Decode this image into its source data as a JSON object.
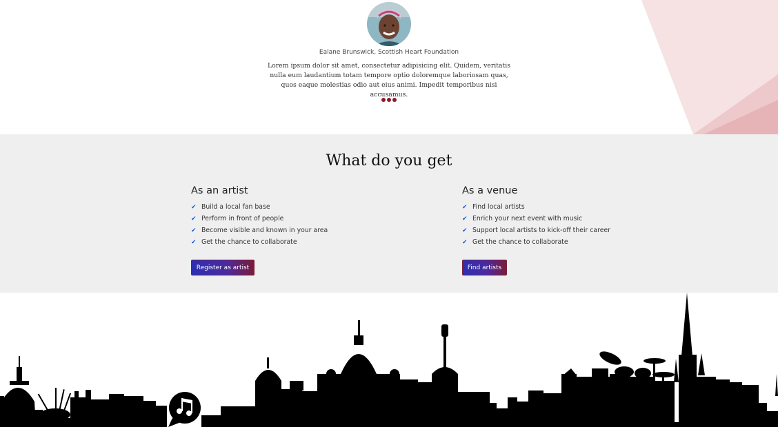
{
  "testimonial": {
    "author": "Ealane Brunswick, Scottish Heart Foundation",
    "quote": "Lorem ipsum dolor sit amet, consectetur adipisicing elit. Quidem, veritatis nulla eum laudantium totam tempore optio doloremque laboriosam quas, quos eaque molestias odio aut eius animi. Impedit temporibus nisi accusamus.",
    "slide_count": 3
  },
  "benefits": {
    "title": "What do you get",
    "artist": {
      "heading": "As an artist",
      "items": [
        "Build a local fan base",
        "Perform in front of people",
        "Become visible and known in your area",
        "Get the chance to collaborate"
      ],
      "button": "Register as artist"
    },
    "venue": {
      "heading": "As a venue",
      "items": [
        "Find local artists",
        "Enrich your next event with music",
        "Support local artists to kick-off their career",
        "Get the chance to collaborate"
      ],
      "button": "Find artists"
    }
  },
  "icons": {
    "check": "check-icon",
    "music_note": "music-note-bubble-icon"
  },
  "colors": {
    "accent": "#8e1b2b",
    "button_start": "#2d2fb0",
    "button_end": "#7a1a3a",
    "section_bg": "#efefef",
    "check": "#1c5fd6"
  }
}
